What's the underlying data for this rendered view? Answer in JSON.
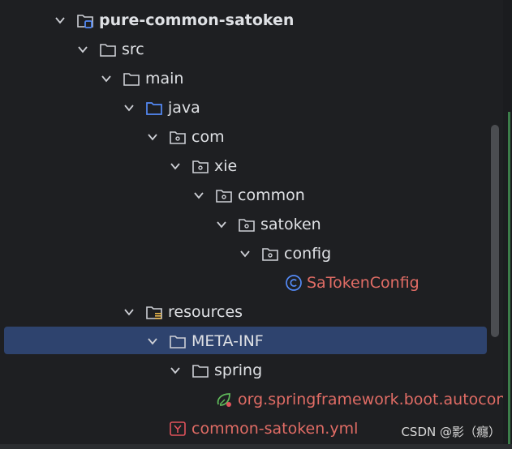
{
  "project_tree": {
    "items": [
      {
        "label": "pure-common-satoken",
        "icon": "module-folder-icon",
        "expanded": true
      },
      {
        "label": "src",
        "icon": "folder-icon",
        "expanded": true
      },
      {
        "label": "main",
        "icon": "folder-icon",
        "expanded": true
      },
      {
        "label": "java",
        "icon": "source-root-folder-icon",
        "expanded": true
      },
      {
        "label": "com",
        "icon": "package-icon",
        "expanded": true
      },
      {
        "label": "xie",
        "icon": "package-icon",
        "expanded": true
      },
      {
        "label": "common",
        "icon": "package-icon",
        "expanded": true
      },
      {
        "label": "satoken",
        "icon": "package-icon",
        "expanded": true
      },
      {
        "label": "config",
        "icon": "package-icon",
        "expanded": true
      },
      {
        "label": "SaTokenConfig",
        "icon": "java-class-icon"
      },
      {
        "label": "resources",
        "icon": "resources-folder-icon",
        "expanded": true
      },
      {
        "label": "META-INF",
        "icon": "folder-icon",
        "expanded": true,
        "selected": true
      },
      {
        "label": "spring",
        "icon": "folder-icon",
        "expanded": true
      },
      {
        "label": "org.springframework.boot.autoconf",
        "icon": "spring-file-icon"
      },
      {
        "label": "common-satoken.yml",
        "icon": "yaml-file-icon"
      }
    ]
  },
  "watermark": "CSDN @影（癮）",
  "colors": {
    "background": "#1e1f22",
    "text": "#dfe1e5",
    "error_text": "#e06c65",
    "selection": "#2e436e",
    "source_folder_blue": "#548af7"
  }
}
